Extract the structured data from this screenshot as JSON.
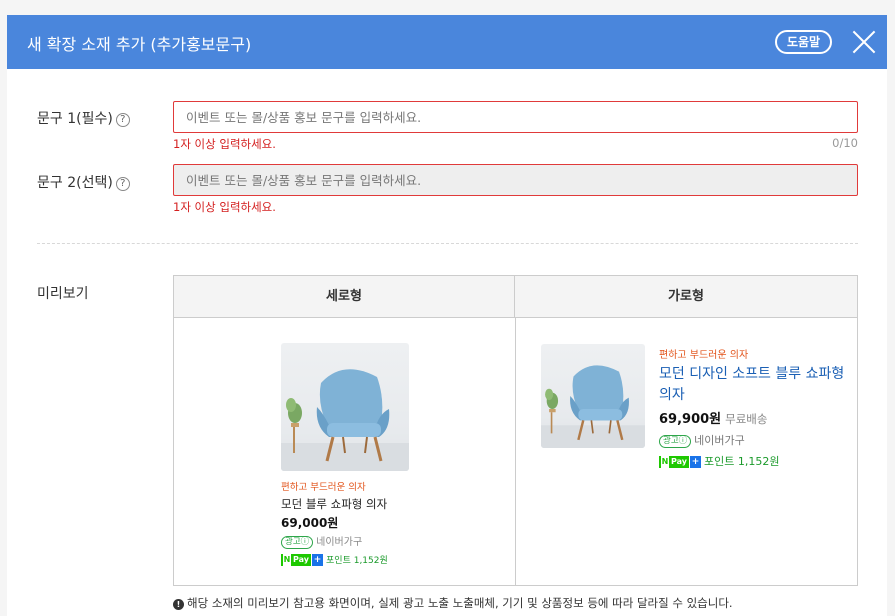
{
  "header": {
    "title": "새 확장 소재 추가 (추가홍보문구)",
    "help_label": "도움말",
    "accent_color": "#4a86dc"
  },
  "form": {
    "field1": {
      "label": "문구 1(필수)",
      "placeholder": "이벤트 또는 몰/상품 홍보 문구를 입력하세요.",
      "value": "",
      "error": "1자 이상 입력하세요.",
      "counter": "0/10"
    },
    "field2": {
      "label": "문구 2(선택)",
      "placeholder": "이벤트 또는 몰/상품 홍보 문구를 입력하세요.",
      "value": "",
      "error": "1자 이상 입력하세요."
    },
    "help_icon": "question-circle-icon"
  },
  "preview": {
    "label": "미리보기",
    "vertical": {
      "header": "세로형",
      "tag": "편하고 부드러운 의자",
      "name": "모던 블루 쇼파형 의자",
      "price": "69,000원",
      "ad_badge": "광고ⓘ",
      "store": "네이버가구",
      "pay_label": "Pay",
      "points": "포인트 1,152원"
    },
    "horizontal": {
      "header": "가로형",
      "tag": "편하고 부드러운 의자",
      "name": "모던 디자인 소프트 블루 쇼파형 의자",
      "price": "69,900원",
      "shipping": "무료배송",
      "ad_badge": "광고ⓘ",
      "store": "네이버가구",
      "pay_label": "Pay",
      "points": "포인트 1,152원"
    },
    "footnote": "해당 소재의 미리보기 참고용 화면이며, 실제 광고 노출 노출매체, 기기 및 상품정보 등에 따라 달라질 수 있습니다."
  }
}
